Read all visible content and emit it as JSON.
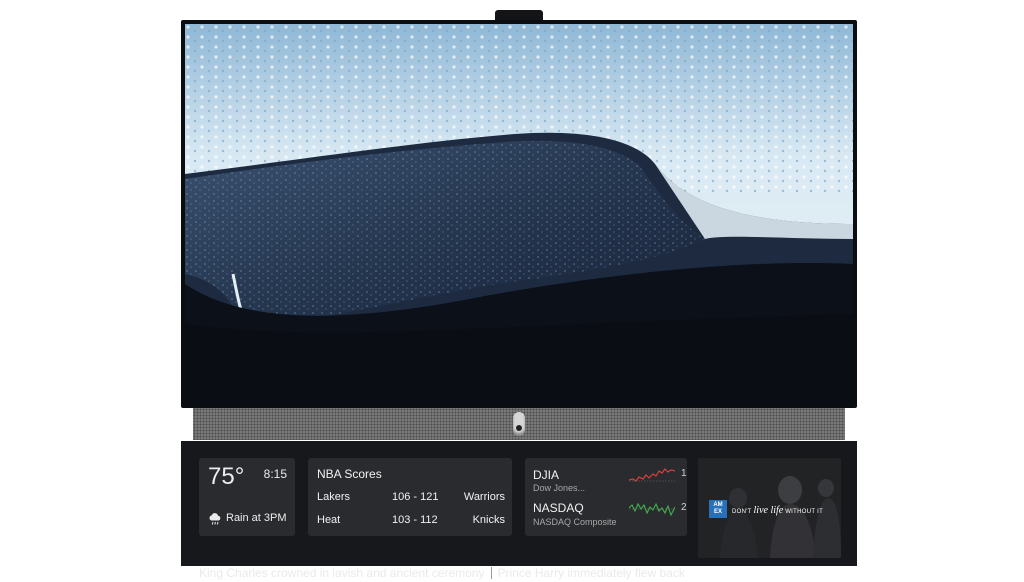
{
  "weather": {
    "temperature": "75°",
    "time": "8:15",
    "forecast": "Rain at 3PM",
    "icon": "rain-cloud-icon"
  },
  "nba": {
    "title": "NBA Scores",
    "games": [
      {
        "home": "Lakers",
        "score": "106 - 121",
        "away": "Warriors"
      },
      {
        "home": "Heat",
        "score": "103 - 112",
        "away": "Knicks"
      }
    ]
  },
  "stocks": [
    {
      "name": "DJIA",
      "subtitle": "Dow Jones...",
      "value": "1",
      "trend_color": "#e0403a"
    },
    {
      "name": "NASDAQ",
      "subtitle": "NASDAQ Composite",
      "value": "2",
      "trend_color": "#3fb24a"
    }
  ],
  "ad": {
    "logo_text": "AM EX",
    "tagline_pre": "DON'T ",
    "tagline_script": "live life",
    "tagline_post": " WITHOUT IT",
    "brand_color": "#2671b9"
  },
  "ticker": {
    "headline_1": "King Charles crowned in lavish and ancient ceremony",
    "headline_2": "Prince Harry immediately flew back"
  }
}
